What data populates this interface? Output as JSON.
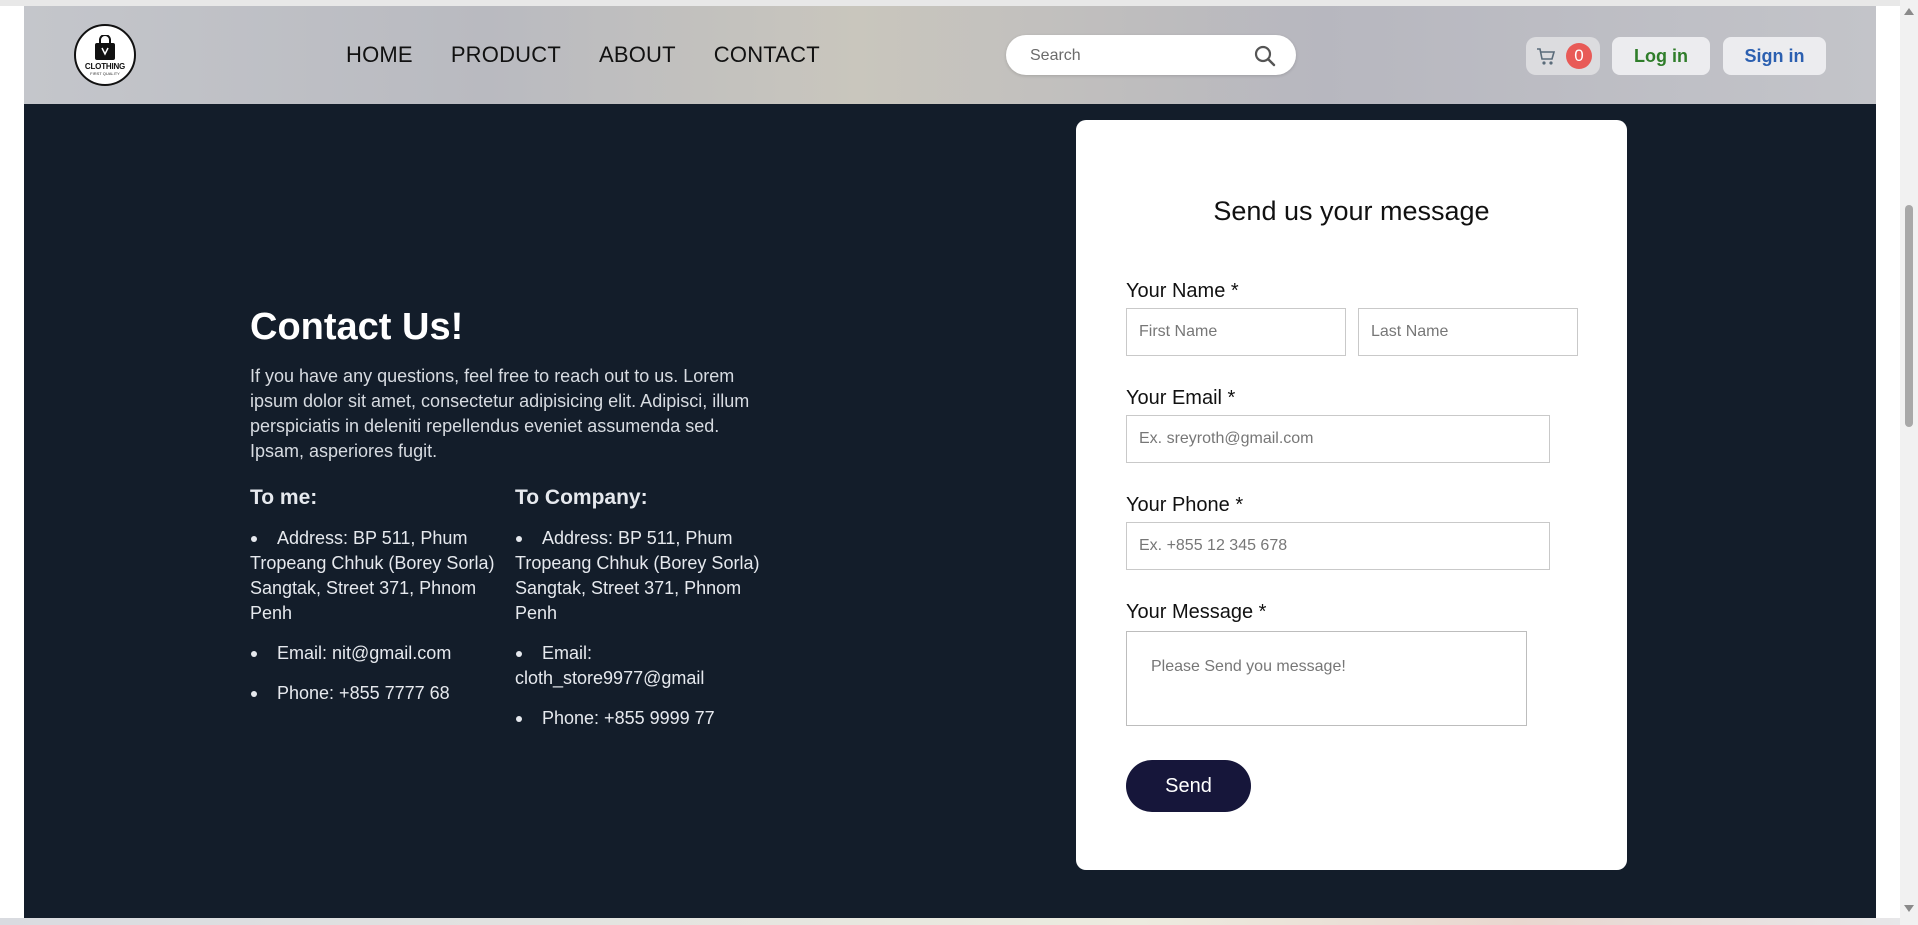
{
  "header": {
    "logo_text": "CLOTHING",
    "logo_sub": "FIRST QUALITY",
    "nav": [
      "HOME",
      "PRODUCT",
      "ABOUT",
      "CONTACT"
    ],
    "search_placeholder": "Search",
    "cart_count": "0",
    "login_label": "Log in",
    "signin_label": "Sign in"
  },
  "contact": {
    "title": "Contact Us!",
    "description": "If you have any questions, feel free to reach out to us. Lorem ipsum dolor sit amet, consectetur adipisicing elit. Adipisci, illum perspiciatis in deleniti repellendus eveniet assumenda sed. Ipsam, asperiores fugit.",
    "to_me": {
      "heading": "To me:",
      "address": "Address: BP 511, Phum Tropeang Chhuk (Borey Sorla) Sangtak, Street 371, Phnom Penh",
      "email": "Email: nit@gmail.com",
      "phone": "Phone: +855 7777 68"
    },
    "to_company": {
      "heading": "To Company:",
      "address": "Address: BP 511, Phum Tropeang Chhuk (Borey Sorla) Sangtak, Street 371, Phnom Penh",
      "email": "Email: cloth_store9977@gmail",
      "phone": "Phone: +855 9999 77"
    }
  },
  "form": {
    "title": "Send us your message",
    "name_label": "Your Name *",
    "first_name_placeholder": "First Name",
    "last_name_placeholder": "Last Name",
    "email_label": "Your Email *",
    "email_placeholder": "Ex. sreyroth@gmail.com",
    "phone_label": "Your Phone *",
    "phone_placeholder": "Ex. +855 12 345 678",
    "message_label": "Your Message *",
    "message_placeholder": "Please Send you message!",
    "send_label": "Send"
  },
  "colors": {
    "page_background": "#131d2a",
    "send_button": "#16163a",
    "cart_badge": "#e85a57",
    "login_text": "#2f7d2a",
    "signin_text": "#2b5fb0"
  },
  "icons": [
    "logo-bag-icon",
    "search-icon",
    "cart-icon",
    "scroll-up-icon",
    "scroll-down-icon"
  ]
}
